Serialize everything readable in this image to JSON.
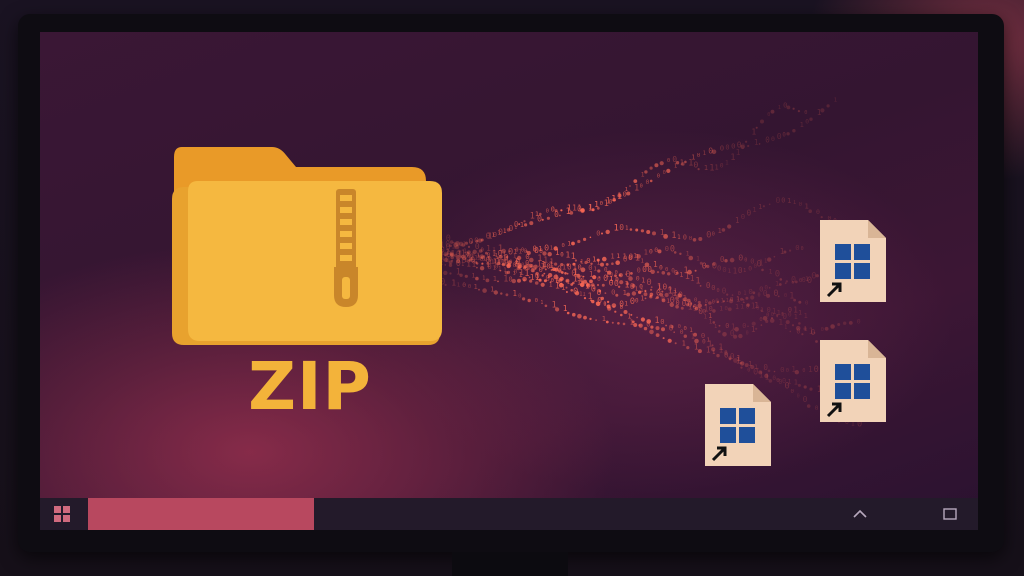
{
  "archive": {
    "label": "ZIP",
    "icon": "zipped-folder-icon",
    "color": "#f3b33a"
  },
  "desktop": {
    "shortcuts": [
      {
        "icon": "windows-shortcut-file-icon",
        "overlay": "shortcut-arrow-icon"
      },
      {
        "icon": "windows-shortcut-file-icon",
        "overlay": "shortcut-arrow-icon"
      },
      {
        "icon": "windows-shortcut-file-icon",
        "overlay": "shortcut-arrow-icon"
      }
    ]
  },
  "taskbar": {
    "start_icon": "windows-logo-icon",
    "active_task_color": "#b8485f",
    "tray_icon": "chevron-up-icon",
    "show_desktop_icon": "square-icon"
  },
  "colors": {
    "background": "#341531",
    "taskbar": "#231a2a",
    "file_paper": "#f2d3b8",
    "windows_blue": "#1f4f9a",
    "particles": "#ff6a55"
  }
}
